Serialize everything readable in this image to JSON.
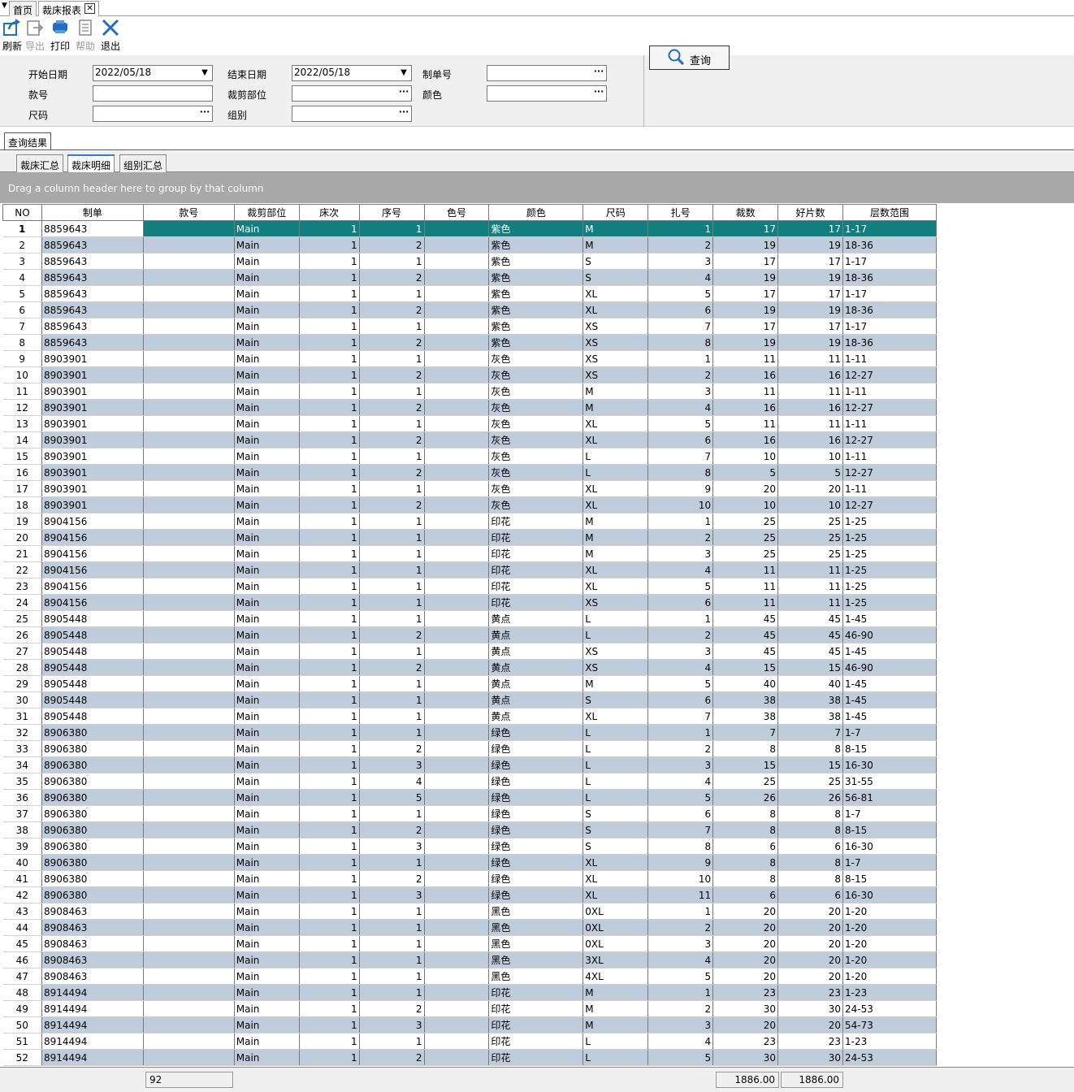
{
  "tabs": [
    {
      "label": "首页"
    },
    {
      "label": "裁床报表"
    }
  ],
  "toolbar": {
    "refresh": "刷新",
    "export": "导出",
    "print": "打印",
    "help": "帮助",
    "exit": "退出"
  },
  "filters": {
    "start_date_label": "开始日期",
    "start_date_value": "2022/05/18",
    "end_date_label": "结束日期",
    "end_date_value": "2022/05/18",
    "order_label": "制单号",
    "style_label": "款号",
    "cut_part_label": "裁剪部位",
    "color_label": "颜色",
    "size_label": "尺码",
    "group_label": "组别",
    "query_button": "查询"
  },
  "result_tab": "查询结果",
  "subtabs": [
    "裁床汇总",
    "裁床明细",
    "组别汇总"
  ],
  "group_hint": "Drag a column header here to group by that column",
  "columns": [
    "NO",
    "制单",
    "款号",
    "裁剪部位",
    "床次",
    "序号",
    "色号",
    "颜色",
    "尺码",
    "扎号",
    "裁数",
    "好片数",
    "层数范围"
  ],
  "rows": [
    [
      "1",
      "8859643",
      "",
      "Main",
      "1",
      "1",
      "",
      "紫色",
      "M",
      "1",
      "17",
      "17",
      "1-17"
    ],
    [
      "2",
      "8859643",
      "",
      "Main",
      "1",
      "2",
      "",
      "紫色",
      "M",
      "2",
      "19",
      "19",
      "18-36"
    ],
    [
      "3",
      "8859643",
      "",
      "Main",
      "1",
      "1",
      "",
      "紫色",
      "S",
      "3",
      "17",
      "17",
      "1-17"
    ],
    [
      "4",
      "8859643",
      "",
      "Main",
      "1",
      "2",
      "",
      "紫色",
      "S",
      "4",
      "19",
      "19",
      "18-36"
    ],
    [
      "5",
      "8859643",
      "",
      "Main",
      "1",
      "1",
      "",
      "紫色",
      "XL",
      "5",
      "17",
      "17",
      "1-17"
    ],
    [
      "6",
      "8859643",
      "",
      "Main",
      "1",
      "2",
      "",
      "紫色",
      "XL",
      "6",
      "19",
      "19",
      "18-36"
    ],
    [
      "7",
      "8859643",
      "",
      "Main",
      "1",
      "1",
      "",
      "紫色",
      "XS",
      "7",
      "17",
      "17",
      "1-17"
    ],
    [
      "8",
      "8859643",
      "",
      "Main",
      "1",
      "2",
      "",
      "紫色",
      "XS",
      "8",
      "19",
      "19",
      "18-36"
    ],
    [
      "9",
      "8903901",
      "",
      "Main",
      "1",
      "1",
      "",
      "灰色",
      "XS",
      "1",
      "11",
      "11",
      "1-11"
    ],
    [
      "10",
      "8903901",
      "",
      "Main",
      "1",
      "2",
      "",
      "灰色",
      "XS",
      "2",
      "16",
      "16",
      "12-27"
    ],
    [
      "11",
      "8903901",
      "",
      "Main",
      "1",
      "1",
      "",
      "灰色",
      "M",
      "3",
      "11",
      "11",
      "1-11"
    ],
    [
      "12",
      "8903901",
      "",
      "Main",
      "1",
      "2",
      "",
      "灰色",
      "M",
      "4",
      "16",
      "16",
      "12-27"
    ],
    [
      "13",
      "8903901",
      "",
      "Main",
      "1",
      "1",
      "",
      "灰色",
      "XL",
      "5",
      "11",
      "11",
      "1-11"
    ],
    [
      "14",
      "8903901",
      "",
      "Main",
      "1",
      "2",
      "",
      "灰色",
      "XL",
      "6",
      "16",
      "16",
      "12-27"
    ],
    [
      "15",
      "8903901",
      "",
      "Main",
      "1",
      "1",
      "",
      "灰色",
      "L",
      "7",
      "10",
      "10",
      "1-11"
    ],
    [
      "16",
      "8903901",
      "",
      "Main",
      "1",
      "2",
      "",
      "灰色",
      "L",
      "8",
      "5",
      "5",
      "12-27"
    ],
    [
      "17",
      "8903901",
      "",
      "Main",
      "1",
      "1",
      "",
      "灰色",
      "XL",
      "9",
      "20",
      "20",
      "1-11"
    ],
    [
      "18",
      "8903901",
      "",
      "Main",
      "1",
      "2",
      "",
      "灰色",
      "XL",
      "10",
      "10",
      "10",
      "12-27"
    ],
    [
      "19",
      "8904156",
      "",
      "Main",
      "1",
      "1",
      "",
      "印花",
      "M",
      "1",
      "25",
      "25",
      "1-25"
    ],
    [
      "20",
      "8904156",
      "",
      "Main",
      "1",
      "1",
      "",
      "印花",
      "M",
      "2",
      "25",
      "25",
      "1-25"
    ],
    [
      "21",
      "8904156",
      "",
      "Main",
      "1",
      "1",
      "",
      "印花",
      "M",
      "3",
      "25",
      "25",
      "1-25"
    ],
    [
      "22",
      "8904156",
      "",
      "Main",
      "1",
      "1",
      "",
      "印花",
      "XL",
      "4",
      "11",
      "11",
      "1-25"
    ],
    [
      "23",
      "8904156",
      "",
      "Main",
      "1",
      "1",
      "",
      "印花",
      "XL",
      "5",
      "11",
      "11",
      "1-25"
    ],
    [
      "24",
      "8904156",
      "",
      "Main",
      "1",
      "1",
      "",
      "印花",
      "XS",
      "6",
      "11",
      "11",
      "1-25"
    ],
    [
      "25",
      "8905448",
      "",
      "Main",
      "1",
      "1",
      "",
      "黄点",
      "L",
      "1",
      "45",
      "45",
      "1-45"
    ],
    [
      "26",
      "8905448",
      "",
      "Main",
      "1",
      "2",
      "",
      "黄点",
      "L",
      "2",
      "45",
      "45",
      "46-90"
    ],
    [
      "27",
      "8905448",
      "",
      "Main",
      "1",
      "1",
      "",
      "黄点",
      "XS",
      "3",
      "45",
      "45",
      "1-45"
    ],
    [
      "28",
      "8905448",
      "",
      "Main",
      "1",
      "2",
      "",
      "黄点",
      "XS",
      "4",
      "15",
      "15",
      "46-90"
    ],
    [
      "29",
      "8905448",
      "",
      "Main",
      "1",
      "1",
      "",
      "黄点",
      "M",
      "5",
      "40",
      "40",
      "1-45"
    ],
    [
      "30",
      "8905448",
      "",
      "Main",
      "1",
      "1",
      "",
      "黄点",
      "S",
      "6",
      "38",
      "38",
      "1-45"
    ],
    [
      "31",
      "8905448",
      "",
      "Main",
      "1",
      "1",
      "",
      "黄点",
      "XL",
      "7",
      "38",
      "38",
      "1-45"
    ],
    [
      "32",
      "8906380",
      "",
      "Main",
      "1",
      "1",
      "",
      "绿色",
      "L",
      "1",
      "7",
      "7",
      "1-7"
    ],
    [
      "33",
      "8906380",
      "",
      "Main",
      "1",
      "2",
      "",
      "绿色",
      "L",
      "2",
      "8",
      "8",
      "8-15"
    ],
    [
      "34",
      "8906380",
      "",
      "Main",
      "1",
      "3",
      "",
      "绿色",
      "L",
      "3",
      "15",
      "15",
      "16-30"
    ],
    [
      "35",
      "8906380",
      "",
      "Main",
      "1",
      "4",
      "",
      "绿色",
      "L",
      "4",
      "25",
      "25",
      "31-55"
    ],
    [
      "36",
      "8906380",
      "",
      "Main",
      "1",
      "5",
      "",
      "绿色",
      "L",
      "5",
      "26",
      "26",
      "56-81"
    ],
    [
      "37",
      "8906380",
      "",
      "Main",
      "1",
      "1",
      "",
      "绿色",
      "S",
      "6",
      "8",
      "8",
      "1-7"
    ],
    [
      "38",
      "8906380",
      "",
      "Main",
      "1",
      "2",
      "",
      "绿色",
      "S",
      "7",
      "8",
      "8",
      "8-15"
    ],
    [
      "39",
      "8906380",
      "",
      "Main",
      "1",
      "3",
      "",
      "绿色",
      "S",
      "8",
      "6",
      "6",
      "16-30"
    ],
    [
      "40",
      "8906380",
      "",
      "Main",
      "1",
      "1",
      "",
      "绿色",
      "XL",
      "9",
      "8",
      "8",
      "1-7"
    ],
    [
      "41",
      "8906380",
      "",
      "Main",
      "1",
      "2",
      "",
      "绿色",
      "XL",
      "10",
      "8",
      "8",
      "8-15"
    ],
    [
      "42",
      "8906380",
      "",
      "Main",
      "1",
      "3",
      "",
      "绿色",
      "XL",
      "11",
      "6",
      "6",
      "16-30"
    ],
    [
      "43",
      "8908463",
      "",
      "Main",
      "1",
      "1",
      "",
      "黑色",
      "0XL",
      "1",
      "20",
      "20",
      "1-20"
    ],
    [
      "44",
      "8908463",
      "",
      "Main",
      "1",
      "1",
      "",
      "黑色",
      "0XL",
      "2",
      "20",
      "20",
      "1-20"
    ],
    [
      "45",
      "8908463",
      "",
      "Main",
      "1",
      "1",
      "",
      "黑色",
      "0XL",
      "3",
      "20",
      "20",
      "1-20"
    ],
    [
      "46",
      "8908463",
      "",
      "Main",
      "1",
      "1",
      "",
      "黑色",
      "3XL",
      "4",
      "20",
      "20",
      "1-20"
    ],
    [
      "47",
      "8908463",
      "",
      "Main",
      "1",
      "1",
      "",
      "黑色",
      "4XL",
      "5",
      "20",
      "20",
      "1-20"
    ],
    [
      "48",
      "8914494",
      "",
      "Main",
      "1",
      "1",
      "",
      "印花",
      "M",
      "1",
      "23",
      "23",
      "1-23"
    ],
    [
      "49",
      "8914494",
      "",
      "Main",
      "1",
      "2",
      "",
      "印花",
      "M",
      "2",
      "30",
      "30",
      "24-53"
    ],
    [
      "50",
      "8914494",
      "",
      "Main",
      "1",
      "3",
      "",
      "印花",
      "M",
      "3",
      "20",
      "20",
      "54-73"
    ],
    [
      "51",
      "8914494",
      "",
      "Main",
      "1",
      "1",
      "",
      "印花",
      "L",
      "4",
      "23",
      "23",
      "1-23"
    ],
    [
      "52",
      "8914494",
      "",
      "Main",
      "1",
      "2",
      "",
      "印花",
      "L",
      "5",
      "30",
      "30",
      "24-53"
    ]
  ],
  "footer": {
    "count": "92",
    "cut_total": "1886.00",
    "good_total": "1886.00"
  },
  "colors": {
    "selected_row": "#117f7f",
    "alt_row": "#bfccdb",
    "group_bar": "#a8a8a8",
    "accent": "#2a7dd8"
  }
}
